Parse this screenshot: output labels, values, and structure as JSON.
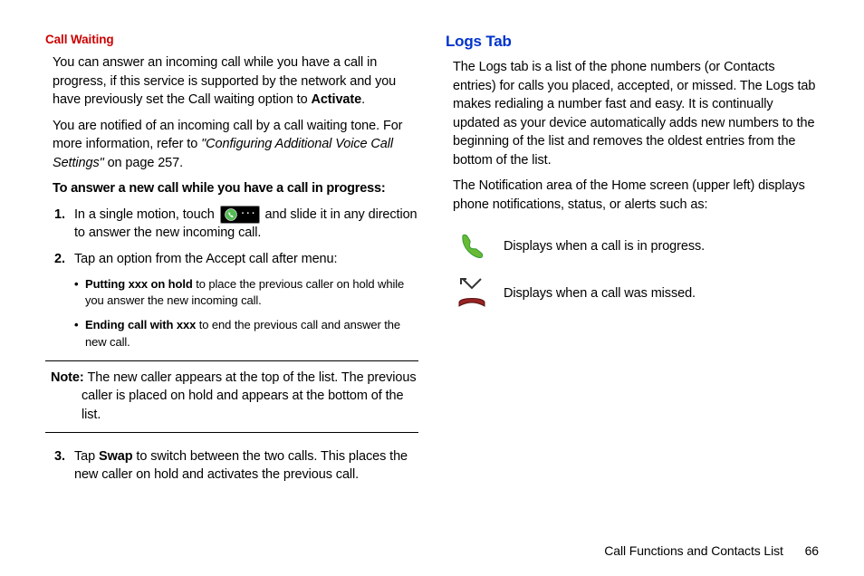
{
  "left": {
    "h_red": "Call Waiting",
    "p1a": "You can answer an incoming call while you have a call in progress, if this service is supported by the network and you have previously set the Call waiting option to ",
    "p1b": "Activate",
    "p1c": ".",
    "p2a": "You are notified of an incoming call by a call waiting tone. For more information, refer to ",
    "p2b": "\"Configuring Additional Voice Call Settings\"",
    "p2c": "  on page 257.",
    "sub": "To answer a new call while you have a call in progress:",
    "s1a": "In a single motion, touch ",
    "s1b": " and slide it in any direction to answer the new incoming call.",
    "s2": "Tap an option from the Accept call after menu:",
    "b1a": "Putting xxx on hold",
    "b1b": " to place the previous caller on hold while you answer the new incoming call.",
    "b2a": "Ending call with xxx",
    "b2b": " to end the previous call and answer the new call.",
    "noteL": "Note: ",
    "note": "The new caller appears at the top of the list. The previous caller is placed on hold and appears at the bottom of the list.",
    "s3a": "Tap ",
    "s3b": "Swap",
    "s3c": " to switch between the two calls. This places the new caller on hold and activates the previous call."
  },
  "right": {
    "h_blue": "Logs Tab",
    "p1": "The Logs tab is a list of the phone numbers (or Contacts entries) for calls you placed, accepted, or missed. The Logs tab makes redialing a number fast and easy. It is continually updated as your device automatically adds new numbers to the beginning of the list and removes the oldest entries from the bottom of the list.",
    "p2": "The Notification area of the Home screen (upper left) displays phone notifications, status, or alerts such as:",
    "row1": "Displays when a call is in progress.",
    "row2": "Displays when a call was missed."
  },
  "footer": {
    "text": "Call Functions and Contacts List",
    "page": "66"
  }
}
